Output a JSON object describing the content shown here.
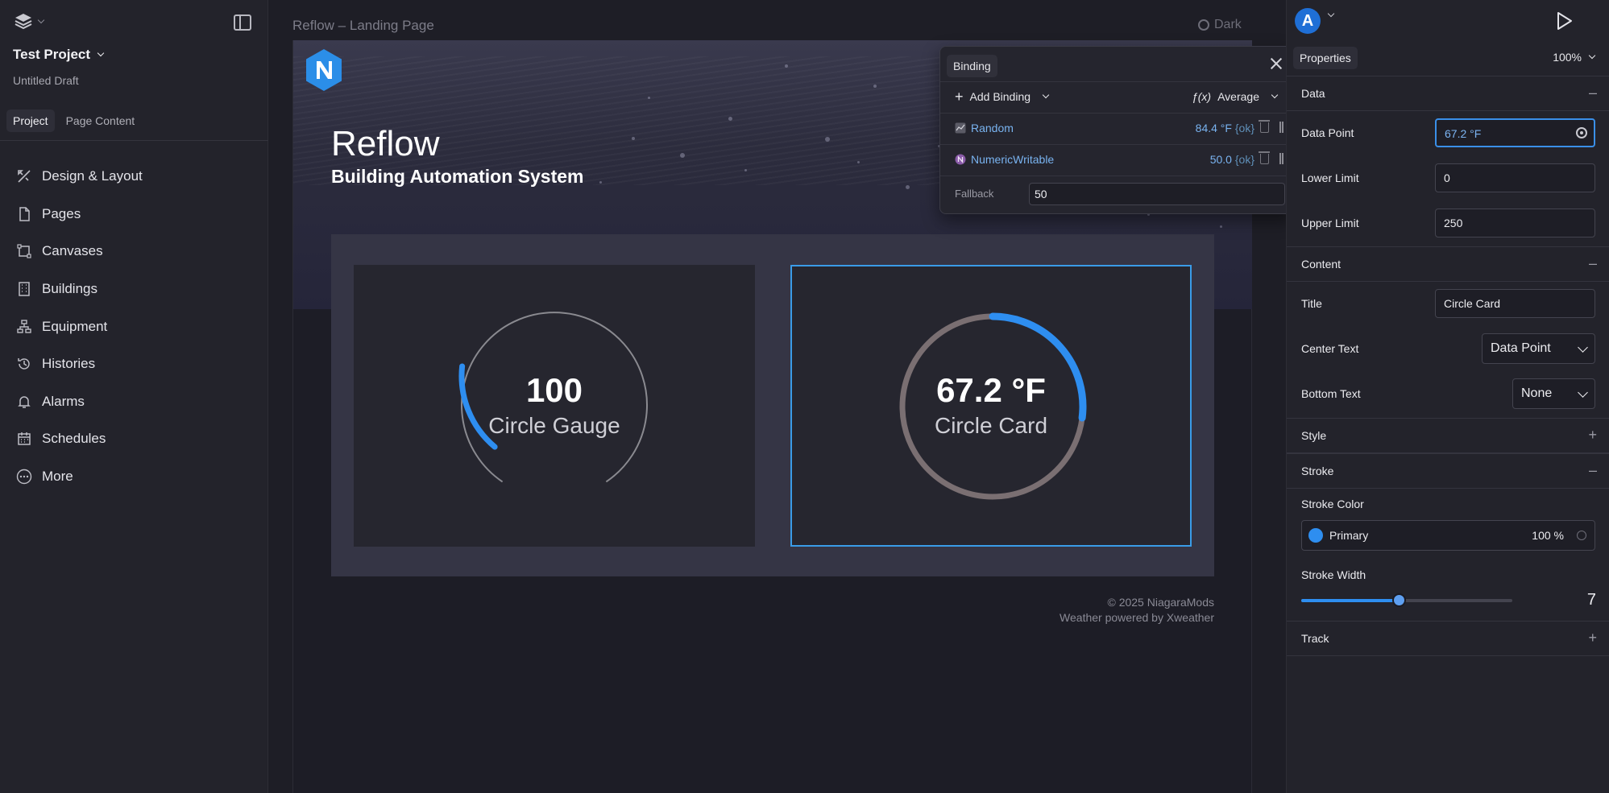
{
  "left_sidebar": {
    "project_name": "Test Project",
    "draft_name": "Untitled Draft",
    "tabs": [
      {
        "label": "Project",
        "active": true
      },
      {
        "label": "Page Content",
        "active": false
      }
    ],
    "nav": [
      {
        "label": "Design & Layout",
        "icon": "design-icon"
      },
      {
        "label": "Pages",
        "icon": "page-icon"
      },
      {
        "label": "Canvases",
        "icon": "canvas-icon"
      },
      {
        "label": "Buildings",
        "icon": "building-icon"
      },
      {
        "label": "Equipment",
        "icon": "equipment-icon"
      },
      {
        "label": "Histories",
        "icon": "history-icon"
      },
      {
        "label": "Alarms",
        "icon": "bell-icon"
      },
      {
        "label": "Schedules",
        "icon": "calendar-icon"
      },
      {
        "label": "More",
        "icon": "more-icon"
      }
    ]
  },
  "canvas": {
    "title": "Reflow – Landing Page",
    "theme_toggle": "Dark",
    "hero": {
      "title": "Reflow",
      "subtitle": "Building Automation System"
    },
    "cards": [
      {
        "value": "100",
        "label": "Circle Gauge",
        "progress_fraction": 0.2
      },
      {
        "value": "67.2 °F",
        "label": "Circle Card",
        "progress_fraction": 0.27
      }
    ],
    "footer": {
      "copyright": "© 2025 NiagaraMods",
      "weather": "Weather powered by Xweather"
    }
  },
  "binding_popup": {
    "tab": "Binding",
    "add_label": "Add Binding",
    "function_label": "Average",
    "sources": [
      {
        "name": "Random",
        "value": "84.4 °F",
        "status": "{ok}"
      },
      {
        "name": "NumericWritable",
        "value": "50.0",
        "status": "{ok}"
      }
    ],
    "fallback_label": "Fallback",
    "fallback_value": "50"
  },
  "right_panel": {
    "avatar_letter": "A",
    "tab": "Properties",
    "zoom": "100%",
    "sections": {
      "data": "Data",
      "content": "Content",
      "style": "Style",
      "stroke": "Stroke",
      "track": "Track"
    },
    "data_point": {
      "label": "Data Point",
      "value": "67.2 °F"
    },
    "lower_limit": {
      "label": "Lower Limit",
      "value": "0"
    },
    "upper_limit": {
      "label": "Upper Limit",
      "value": "250"
    },
    "title_field": {
      "label": "Title",
      "value": "Circle Card"
    },
    "center_text": {
      "label": "Center Text",
      "value": "Data Point"
    },
    "bottom_text": {
      "label": "Bottom Text",
      "value": "None"
    },
    "stroke_color": {
      "label": "Stroke Color",
      "name": "Primary",
      "opacity": "100 %",
      "color": "#2e8ef0"
    },
    "stroke_width": {
      "label": "Stroke Width",
      "value": "7",
      "fraction": 0.46
    }
  },
  "colors": {
    "accent": "#2e8ef0",
    "selection": "#3a9ce8",
    "track": "#7a6f72"
  }
}
